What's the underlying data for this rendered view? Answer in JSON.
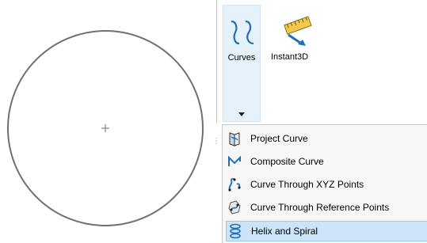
{
  "ribbon": {
    "curves_label": "Curves",
    "instant3d_label": "Instant3D"
  },
  "menu": {
    "items": [
      {
        "label": "Project Curve",
        "icon": "project-curve-icon"
      },
      {
        "label": "Composite Curve",
        "icon": "composite-curve-icon"
      },
      {
        "label": "Curve Through XYZ Points",
        "icon": "curve-xyz-points-icon"
      },
      {
        "label": "Curve Through Reference Points",
        "icon": "curve-reference-points-icon"
      },
      {
        "label": "Helix and Spiral",
        "icon": "helix-spiral-icon",
        "highlighted": true
      }
    ]
  },
  "colors": {
    "accent": "#1f6fb5",
    "highlight": "#cce4f7"
  }
}
